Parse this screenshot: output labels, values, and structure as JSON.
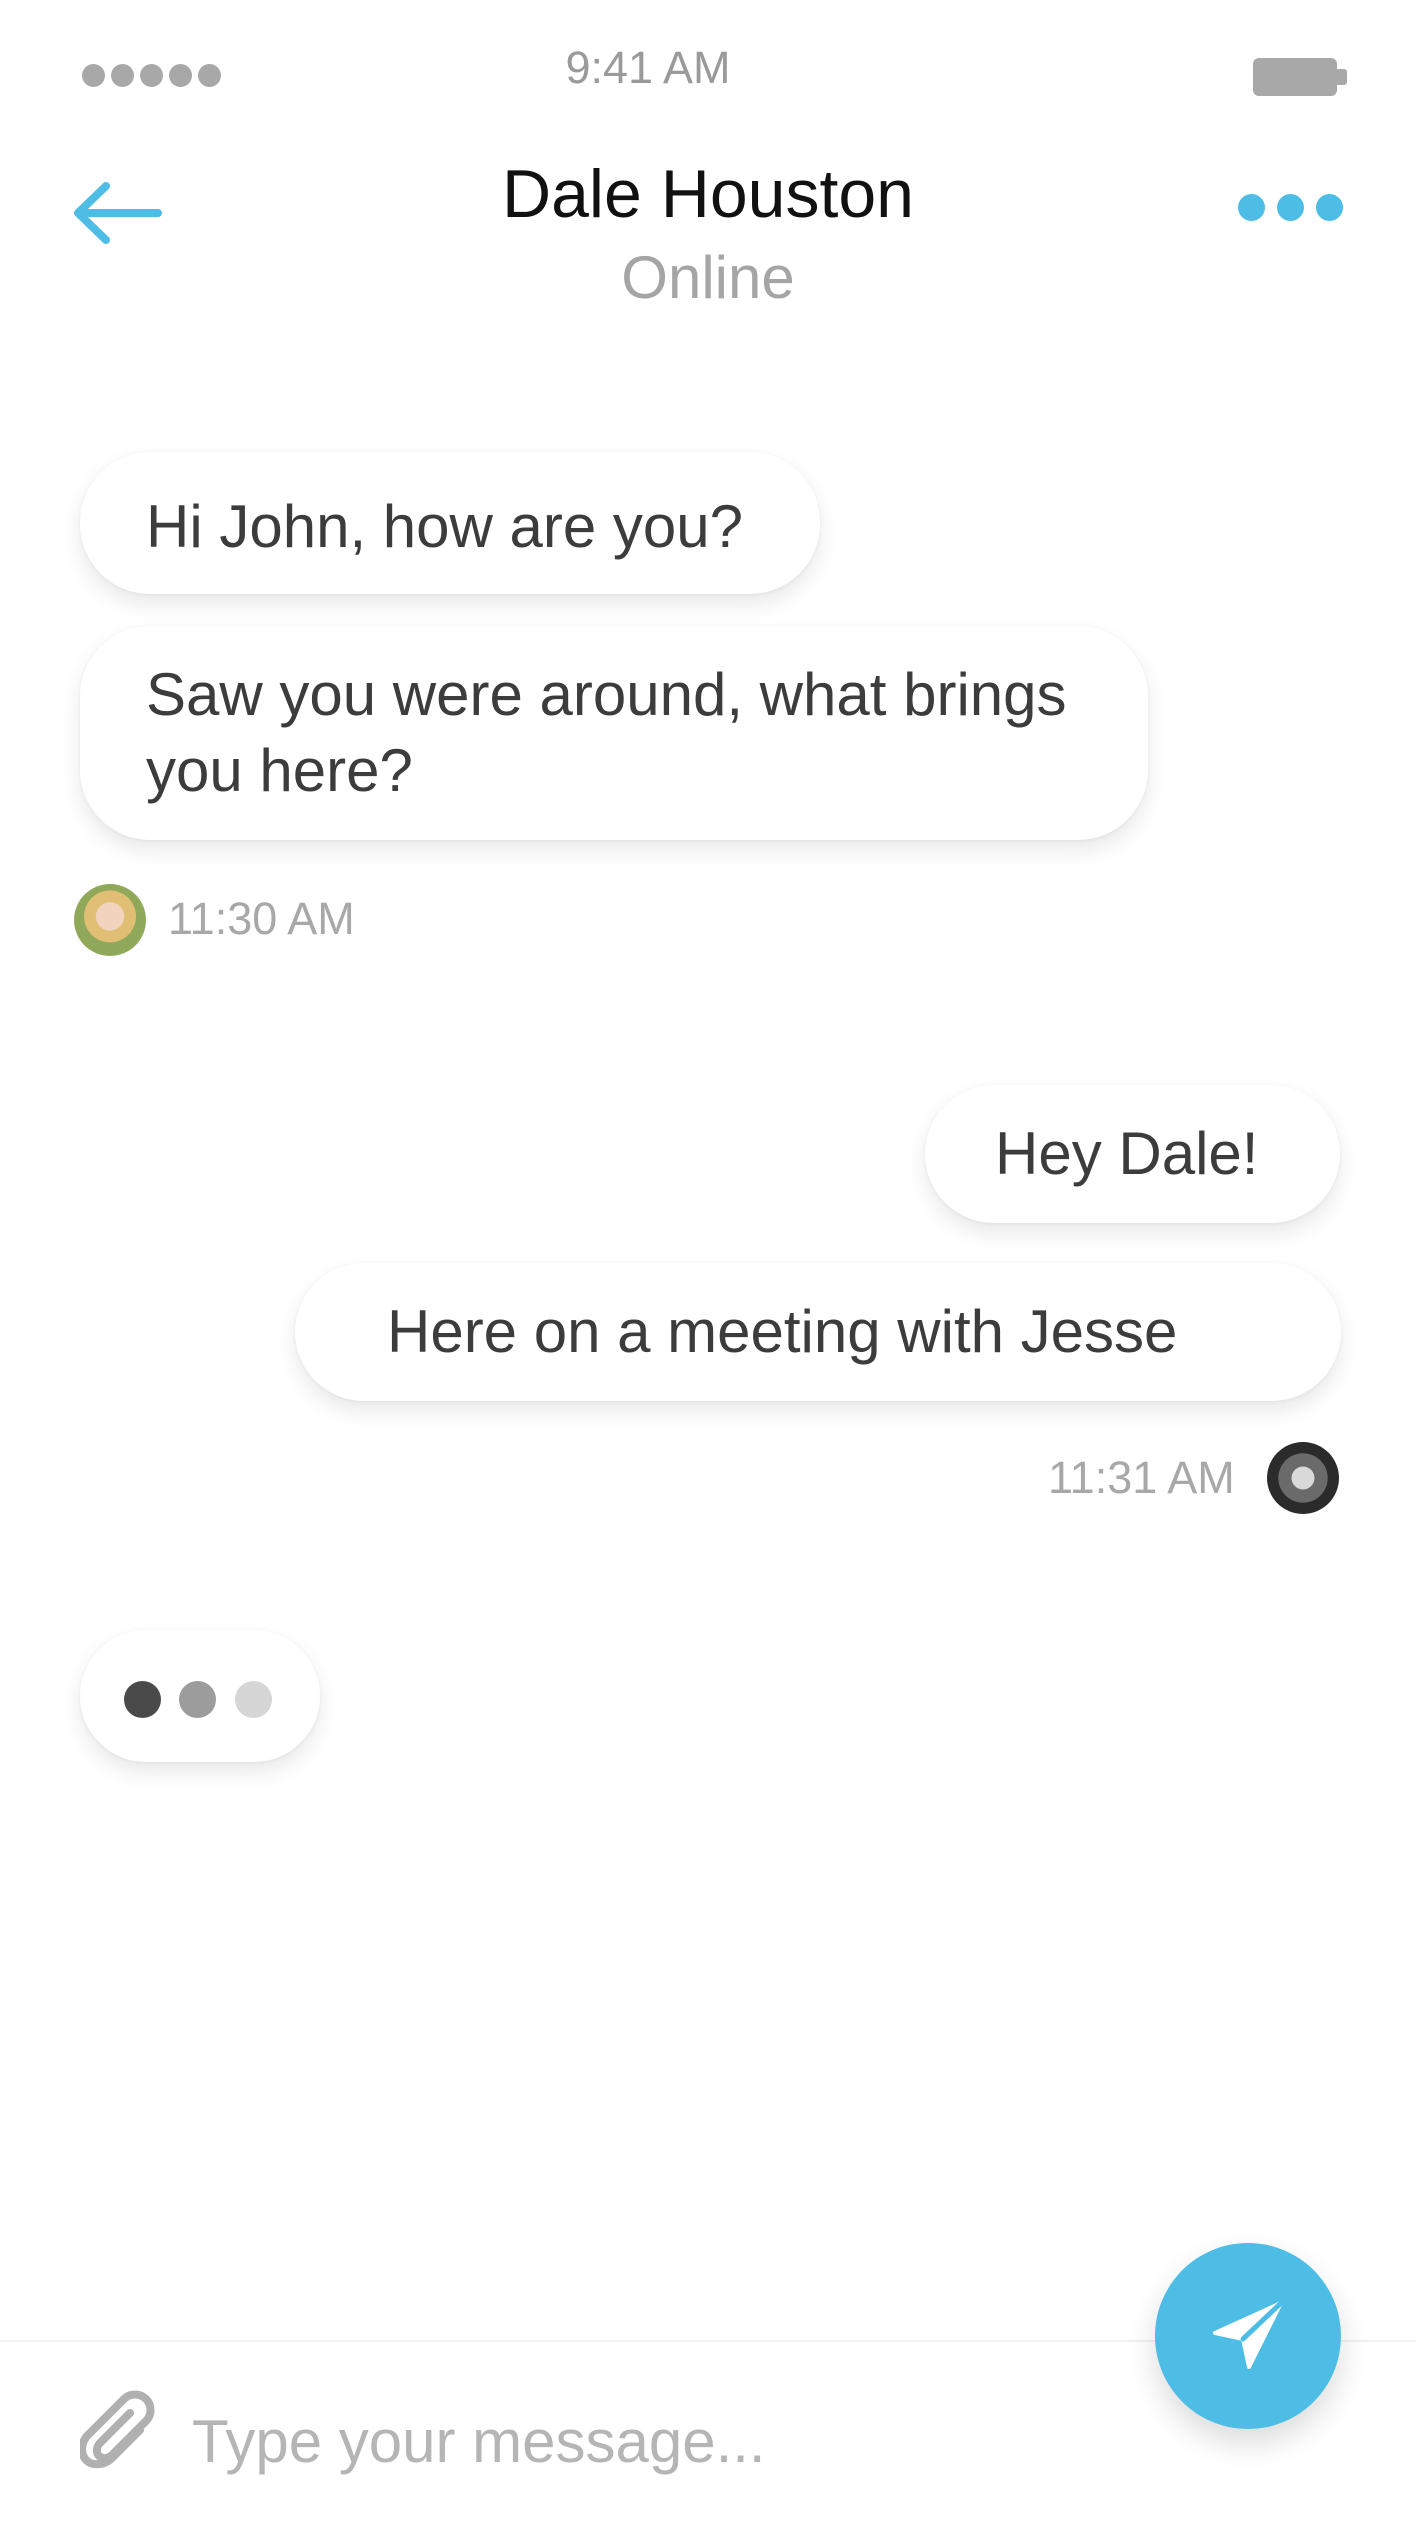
{
  "status_bar": {
    "time": "9:41 AM",
    "signal_dots": 5,
    "battery_icon": "battery-icon"
  },
  "header": {
    "back_icon": "arrow-left-icon",
    "title": "Dale Houston",
    "status": "Online",
    "more_icon": "more-horizontal-icon",
    "accent_color": "#4ebde6"
  },
  "conversation": {
    "incoming": {
      "messages": [
        "Hi John, how are you?",
        "Saw you were around, what brings you here?"
      ],
      "time": "11:30 AM",
      "avatar": "avatar-dale"
    },
    "outgoing": {
      "messages": [
        "Hey Dale!",
        "Here on a meeting with Jesse"
      ],
      "time": "11:31 AM",
      "avatar": "avatar-john"
    },
    "typing_indicator": {
      "dot_colors": [
        "#4a4a4a",
        "#9c9c9c",
        "#d6d6d6"
      ]
    }
  },
  "composer": {
    "attach_icon": "paperclip-icon",
    "placeholder": "Type your message...",
    "value": "",
    "send_icon": "send-icon",
    "send_color": "#4ebde6"
  }
}
